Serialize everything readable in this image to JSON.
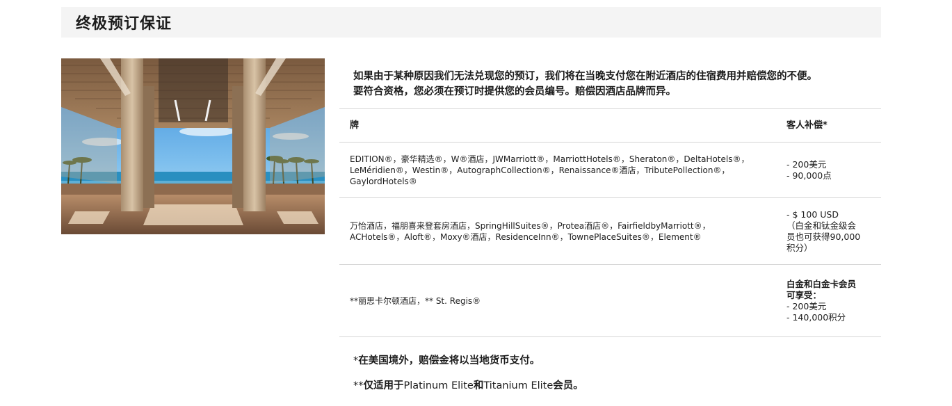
{
  "header": {
    "title": "终极预订保证"
  },
  "intro": {
    "line1": "如果由于某种原因我们无法兑现您的预订，我们将在当晚支付您在附近酒店的住宿费用并赔偿您的不便。",
    "line2": "要符合资格，您必须在预订时提供您的会员编号。赔偿因酒店品牌而异。"
  },
  "table": {
    "col_brand": "牌",
    "col_compensation": "客人补偿*",
    "rows": [
      {
        "brand_lines": [
          "EDITION®，豪华精选®，W®酒店，JWMarriott®，MarriottHotels®，Sheraton®，DeltaHotels®，",
          "LeMéridien®，Westin®，AutographCollection®，Renaissance®酒店，TributePollection®，",
          "GaylordHotels®"
        ],
        "compensation_lines": [
          "- 200美元",
          "- 90,000点"
        ]
      },
      {
        "brand_lines": [
          "万怡酒店，福朋喜来登套房酒店，SpringHillSuites®，Protea酒店®，FairfieldbyMarriott®，",
          "ACHotels®，Aloft®，Moxy®酒店，ResidenceInn®，TownePlaceSuites®，Element®"
        ],
        "compensation_lines": [
          "- $ 100 USD",
          "（白金和钛金级会",
          "员也可获得90,000",
          "积分）"
        ]
      },
      {
        "brand_lines": [
          "**丽思卡尔顿酒店，** St. Regis®"
        ],
        "compensation_heading": [
          "白金和白金卡会员",
          "可享受："
        ],
        "compensation_lines": [
          "- 200美元",
          "- 140,000积分"
        ]
      }
    ]
  },
  "notes": {
    "note1_prefix": "*",
    "note1_text": "在美国境外，赔偿金将以当地货币支付。",
    "note2_prefix": "**",
    "note2_bold1": "仅适用于",
    "note2_mid1": "Platinum Elite",
    "note2_bold2": "和",
    "note2_mid2": "Titanium Elite",
    "note2_bold3": "会员。"
  }
}
